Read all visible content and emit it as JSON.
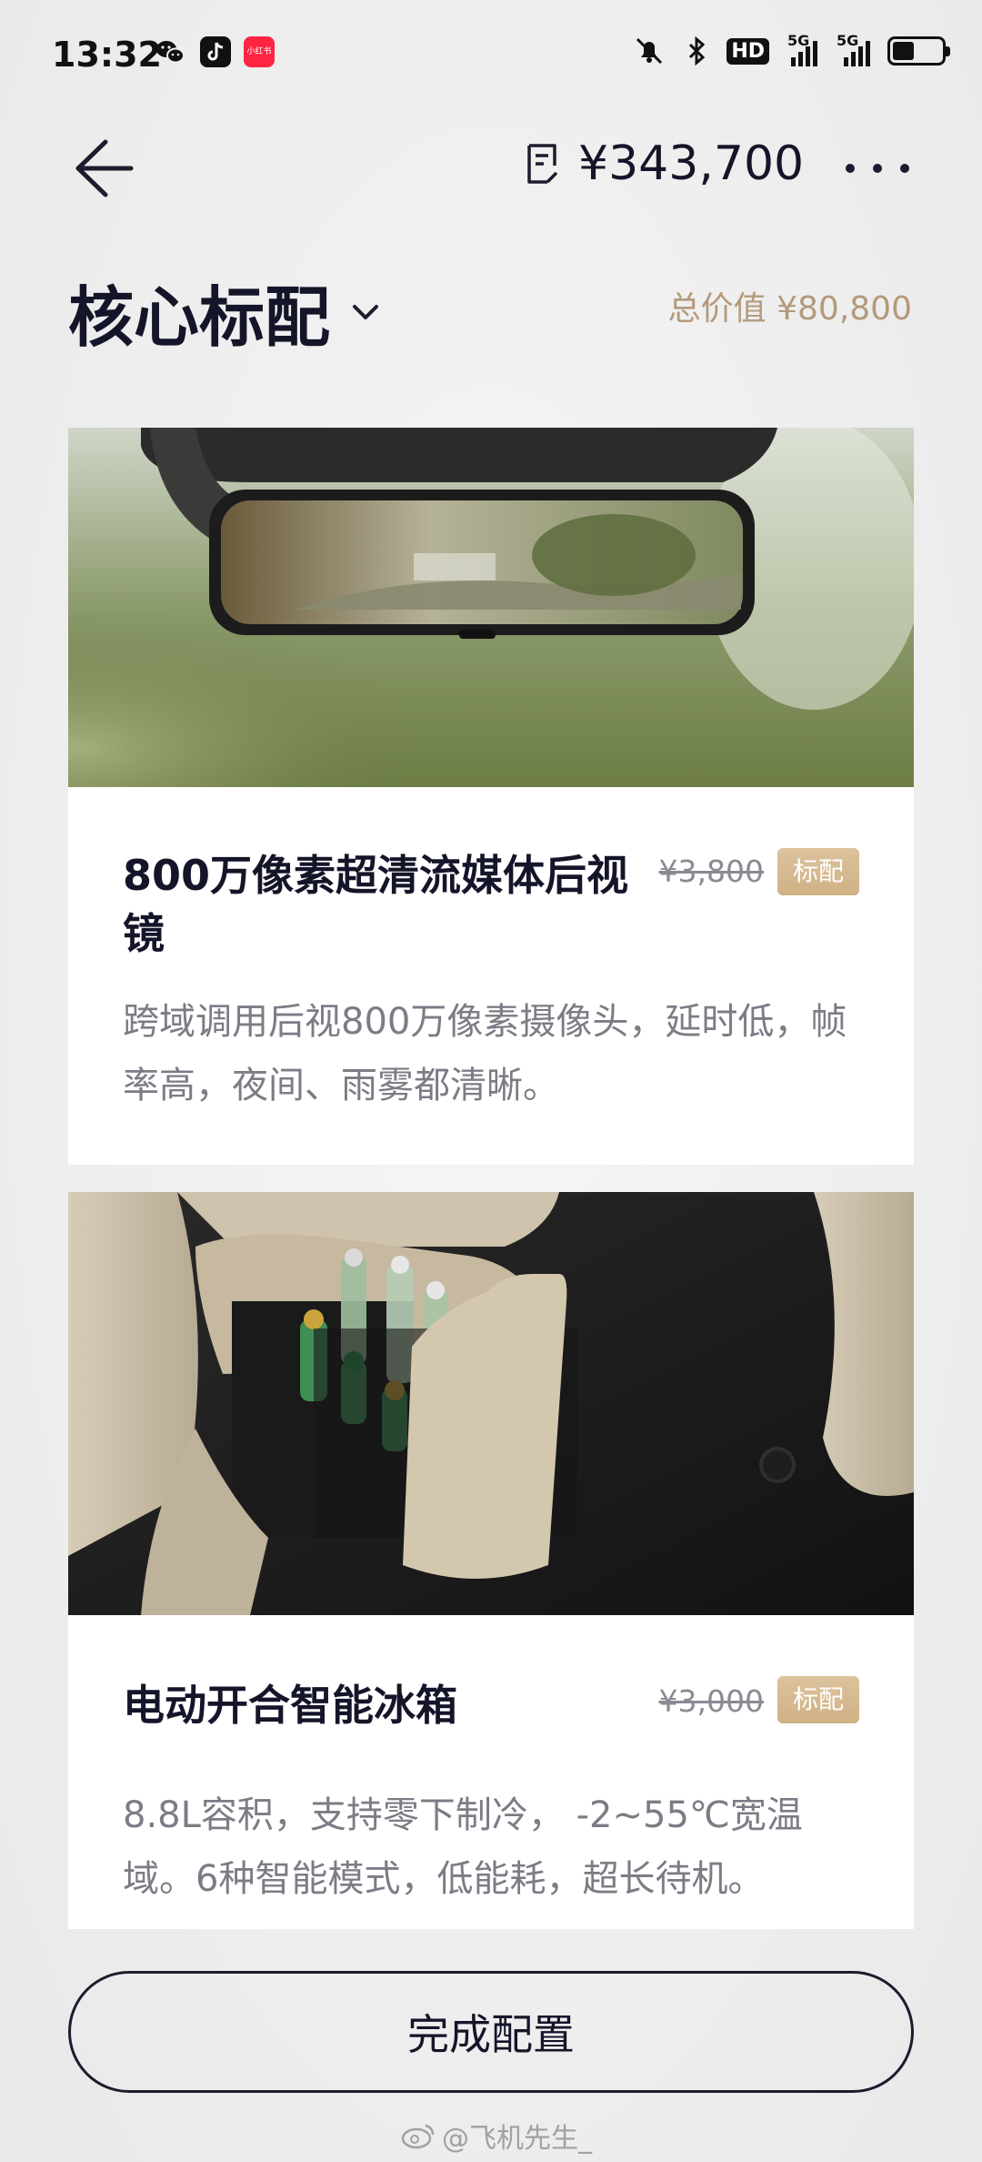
{
  "status_bar": {
    "time": "13:32",
    "apps": [
      "wechat-icon",
      "tiktok-icon",
      "xiaohongshu-icon"
    ],
    "xhs_label": "小红书",
    "hd_label": "HD",
    "network_1": "5G",
    "network_2": "5G",
    "battery_level": 0.45
  },
  "header": {
    "total_price": "¥343,700"
  },
  "section": {
    "title": "核心标配",
    "total_value": "总价值 ¥80,800"
  },
  "cards": [
    {
      "title": "800万像素超清流媒体后视镜",
      "old_price": "¥3,800",
      "badge": "标配",
      "description": "跨域调用后视800万像素摄像头，延时低，帧率高，夜间、雨雾都清晰。"
    },
    {
      "title": "电动开合智能冰箱",
      "old_price": "¥3,000",
      "badge": "标配",
      "description": "8.8L容积，支持零下制冷， -2~55℃宽温域。6种智能模式，低能耗，超长待机。"
    }
  ],
  "footer": {
    "finish_label": "完成配置",
    "watermark": "@飞机先生_"
  },
  "colors": {
    "accent_gold": "#cfb184",
    "total_value_text": "#b49a7b",
    "primary_text": "#15152a"
  }
}
